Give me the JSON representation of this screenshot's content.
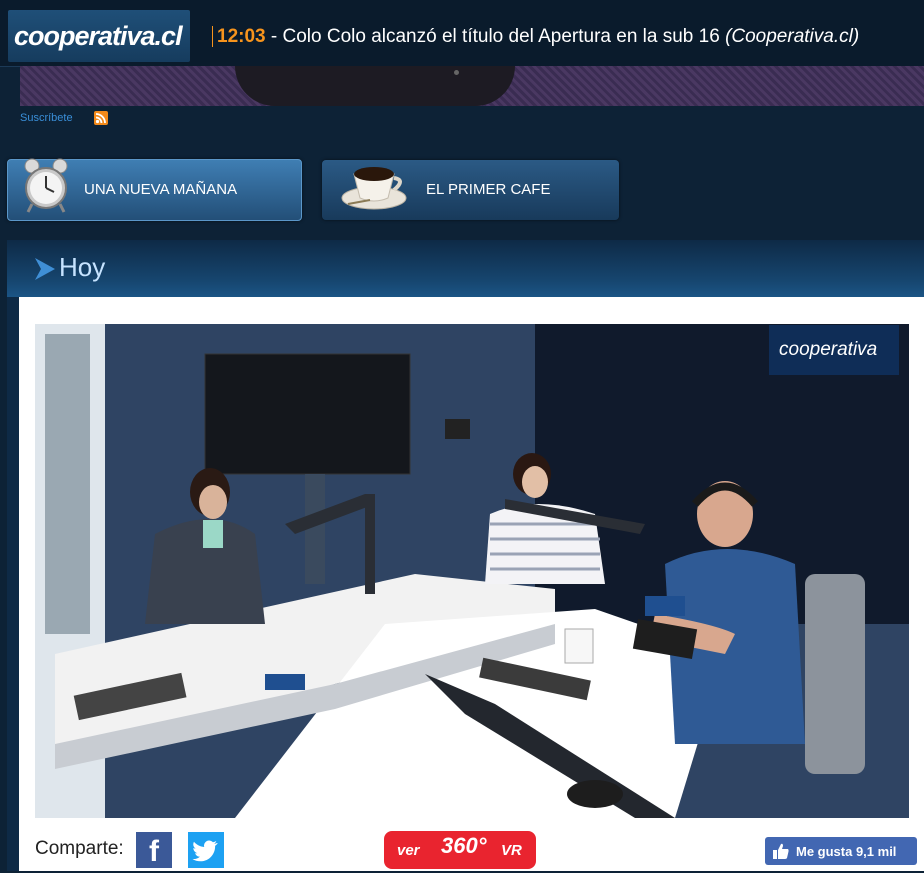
{
  "header": {
    "logo_text": "cooperativa.cl",
    "ticker": {
      "time": "12:03",
      "headline": " - Colo Colo alcanzó el título del Apertura en la sub 16 ",
      "source": "(Cooperativa.cl)"
    }
  },
  "subscribe": {
    "label": "Suscríbete",
    "icon": "rss-icon"
  },
  "programs": [
    {
      "label": "UNA NUEVA MAÑANA",
      "icon": "alarm-clock-icon"
    },
    {
      "label": "EL PRIMER CAFE",
      "icon": "coffee-cup-icon"
    }
  ],
  "section": {
    "title": "Hoy"
  },
  "video": {
    "watermark": "cooperativa"
  },
  "share": {
    "label": "Comparte:",
    "facebook_glyph": "f",
    "vr_prefix": "ver",
    "vr_number": "360°",
    "vr_suffix": "VR",
    "like_text": "Me gusta 9,1 mil"
  },
  "colors": {
    "accent_orange": "#f7941d",
    "header_bg": "#0a1b2c",
    "vr_red": "#e9242f",
    "facebook_blue": "#3b5998",
    "twitter_blue": "#1da1f2"
  }
}
